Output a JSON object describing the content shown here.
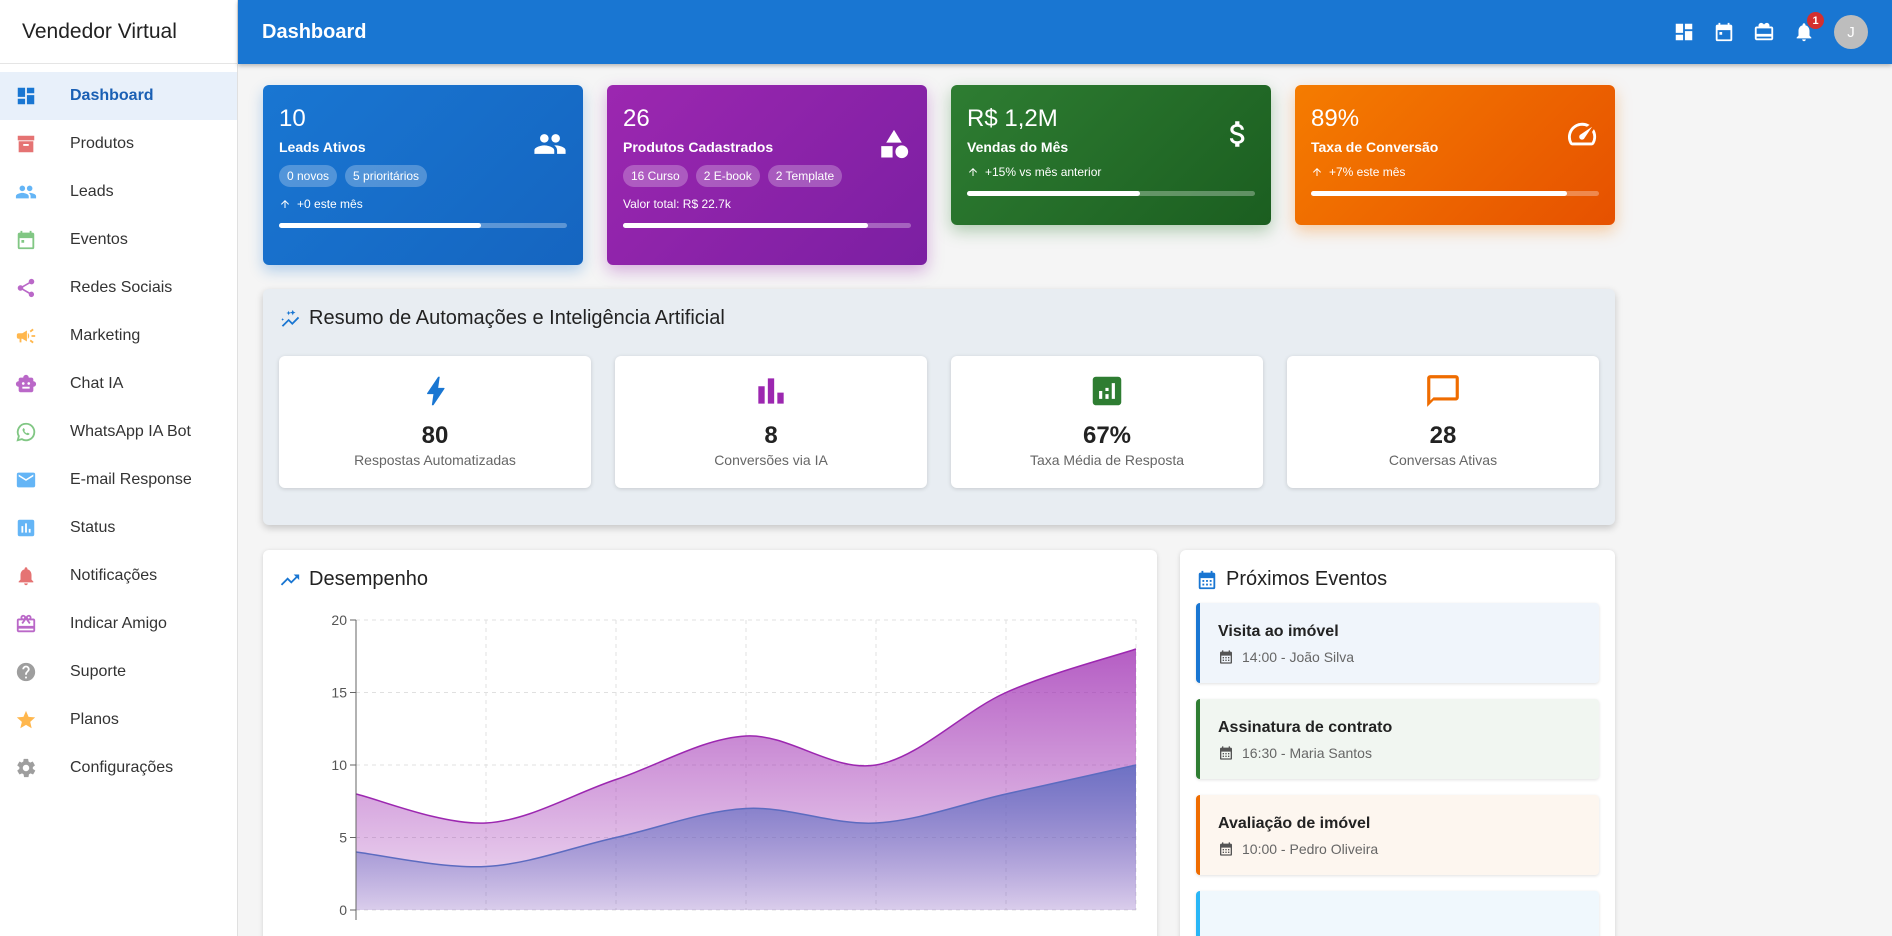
{
  "brand": "Vendedor Virtual",
  "sidebar": {
    "items": [
      {
        "label": "Dashboard",
        "icon": "dashboard-icon",
        "color": "#1976d2"
      },
      {
        "label": "Produtos",
        "icon": "archive-icon",
        "color": "#e57373"
      },
      {
        "label": "Leads",
        "icon": "people-icon",
        "color": "#64b5f6"
      },
      {
        "label": "Eventos",
        "icon": "calendar-icon",
        "color": "#81c784"
      },
      {
        "label": "Redes Sociais",
        "icon": "share-icon",
        "color": "#ba68c8"
      },
      {
        "label": "Marketing",
        "icon": "megaphone-icon",
        "color": "#ffb74d"
      },
      {
        "label": "Chat IA",
        "icon": "robot-icon",
        "color": "#ba68c8"
      },
      {
        "label": "WhatsApp IA Bot",
        "icon": "whatsapp-icon",
        "color": "#81c784"
      },
      {
        "label": "E-mail Response",
        "icon": "mail-icon",
        "color": "#64b5f6"
      },
      {
        "label": "Status",
        "icon": "bar-chart-icon",
        "color": "#64b5f6"
      },
      {
        "label": "Notificações",
        "icon": "bell-icon",
        "color": "#e57373"
      },
      {
        "label": "Indicar Amigo",
        "icon": "gift-icon",
        "color": "#ba68c8"
      },
      {
        "label": "Suporte",
        "icon": "help-icon",
        "color": "#9e9e9e"
      },
      {
        "label": "Planos",
        "icon": "star-icon",
        "color": "#ffb74d"
      },
      {
        "label": "Configurações",
        "icon": "gear-icon",
        "color": "#9e9e9e"
      }
    ]
  },
  "header": {
    "title": "Dashboard",
    "notifications_count": "1",
    "avatar_initial": "J"
  },
  "stats": {
    "leads": {
      "value": "10",
      "label": "Leads Ativos",
      "chip1": "0 novos",
      "chip2": "5 prioritários",
      "sub": "+0 este mês",
      "progress": 0.7
    },
    "products": {
      "value": "26",
      "label": "Produtos Cadastrados",
      "chip1": "16 Curso",
      "chip2": "2 E-book",
      "chip3": "2 Template",
      "sub": "Valor total: R$ 22.7k",
      "progress": 0.85
    },
    "sales": {
      "value": "R$ 1,2M",
      "label": "Vendas do Mês",
      "sub": "+15% vs mês anterior",
      "progress": 0.6
    },
    "conversion": {
      "value": "89%",
      "label": "Taxa de Conversão",
      "sub": "+7% este mês",
      "progress": 0.89
    }
  },
  "ai_summary": {
    "title": "Resumo de Automações e Inteligência Artificial",
    "cards": [
      {
        "value": "80",
        "caption": "Respostas Automatizadas",
        "icon": "bolt-icon",
        "color": "#1976d2"
      },
      {
        "value": "8",
        "caption": "Conversões via IA",
        "icon": "bar-chart-icon",
        "color": "#9c27b0"
      },
      {
        "value": "67%",
        "caption": "Taxa Média de Resposta",
        "icon": "analytics-icon",
        "color": "#2e7d32"
      },
      {
        "value": "28",
        "caption": "Conversas Ativas",
        "icon": "chat-icon",
        "color": "#ef6c00"
      }
    ]
  },
  "performance": {
    "title": "Desempenho"
  },
  "chart_data": {
    "type": "area",
    "title": "",
    "xlabel": "",
    "ylabel": "",
    "ylim": [
      0,
      20
    ],
    "yticks": [
      "0",
      "5",
      "10",
      "15",
      "20"
    ],
    "grid": true,
    "x": [
      0,
      1,
      2,
      3,
      4,
      5,
      6
    ],
    "series": [
      {
        "values": [
          4,
          3,
          5,
          7,
          6,
          8,
          10
        ],
        "color": "#5c6bc0"
      },
      {
        "values": [
          8,
          6,
          9,
          12,
          10,
          15,
          18
        ],
        "color": "#9c27b0"
      }
    ]
  },
  "events": {
    "title": "Próximos Eventos",
    "items": [
      {
        "title": "Visita ao imóvel",
        "detail": "14:00 - João Silva",
        "color": "#1976d2",
        "bg": "#f0f5fb"
      },
      {
        "title": "Assinatura de contrato",
        "detail": "16:30 - Maria Santos",
        "color": "#2e7d32",
        "bg": "#f1f6f1"
      },
      {
        "title": "Avaliação de imóvel",
        "detail": "10:00 - Pedro Oliveira",
        "color": "#ef6c00",
        "bg": "#fdf6ef"
      },
      {
        "title": "",
        "detail": "",
        "color": "#29b6f6",
        "bg": "#f0f8fd"
      }
    ]
  }
}
